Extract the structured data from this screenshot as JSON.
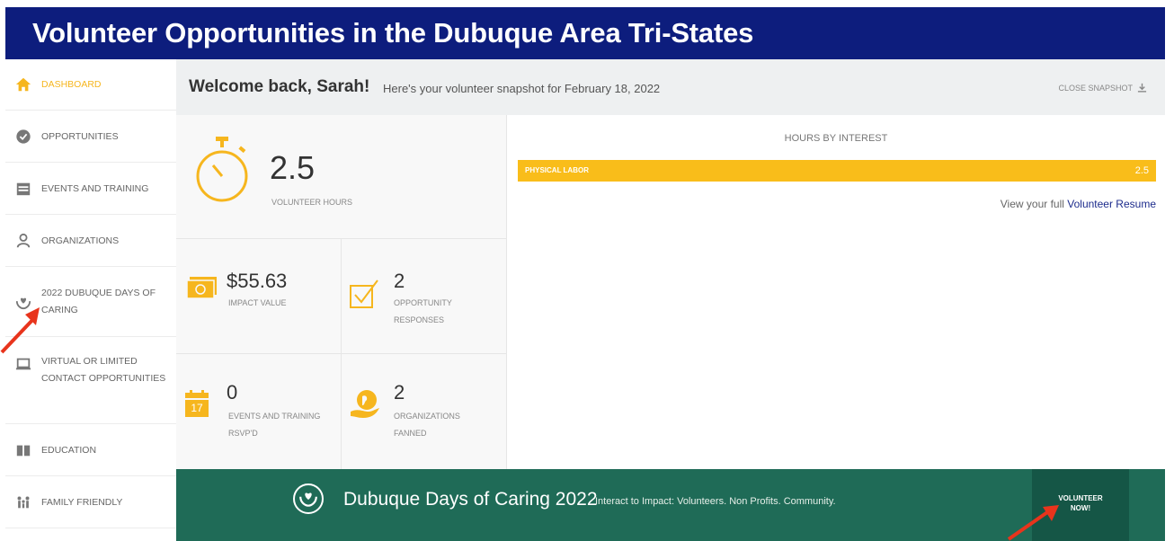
{
  "header": {
    "title": "Volunteer Opportunities in the Dubuque Area Tri-States"
  },
  "sidebar": {
    "items": [
      {
        "label": "DASHBOARD",
        "icon": "home-icon",
        "active": true
      },
      {
        "label": "OPPORTUNITIES",
        "icon": "check-circle-icon",
        "active": false
      },
      {
        "label": "EVENTS AND TRAINING",
        "icon": "calendar-icon",
        "active": false
      },
      {
        "label": "ORGANIZATIONS",
        "icon": "people-icon",
        "active": false
      },
      {
        "label": "2022 DUBUQUE DAYS OF CARING",
        "icon": "hands-heart-icon",
        "active": false
      },
      {
        "label": "VIRTUAL OR LIMITED CONTACT OPPORTUNITIES",
        "icon": "laptop-icon",
        "active": false
      },
      {
        "label": "EDUCATION",
        "icon": "book-icon",
        "active": false
      },
      {
        "label": "FAMILY FRIENDLY",
        "icon": "family-icon",
        "active": false
      }
    ]
  },
  "welcome": {
    "greeting": "Welcome back, Sarah!",
    "subtitle": "Here's your volunteer snapshot for February 18, 2022",
    "close_label": "CLOSE SNAPSHOT"
  },
  "stats": {
    "volunteer_hours": {
      "value": "2.5",
      "label": "VOLUNTEER HOURS"
    },
    "impact_value": {
      "value": "$55.63",
      "label": "IMPACT VALUE"
    },
    "opportunity_responses": {
      "value": "2",
      "label": "OPPORTUNITY RESPONSES"
    },
    "events_rsvpd": {
      "value": "0",
      "label": "EVENTS AND TRAINING RSVP'D",
      "calendar_day": "17"
    },
    "organizations_fanned": {
      "value": "2",
      "label": "ORGANIZATIONS FANNED"
    }
  },
  "hours_chart": {
    "title": "HOURS BY INTEREST",
    "resume_prefix": "View your full",
    "resume_link": "Volunteer Resume"
  },
  "chart_data": {
    "type": "bar",
    "title": "HOURS BY INTEREST",
    "categories": [
      "PHYSICAL LABOR"
    ],
    "values": [
      2.5
    ],
    "value_labels": [
      "2.5"
    ],
    "max": 2.5
  },
  "promo": {
    "title": "Dubuque Days of Caring 2022",
    "subtitle": "Interact to Impact: Volunteers. Non Profits. Community.",
    "button_line1": "VOLUNTEER",
    "button_line2": "NOW!"
  },
  "colors": {
    "header_blue": "#0d1d7d",
    "accent_yellow": "#f6b61e",
    "promo_green": "#1f6b57",
    "annotation_red": "#e8341c"
  }
}
